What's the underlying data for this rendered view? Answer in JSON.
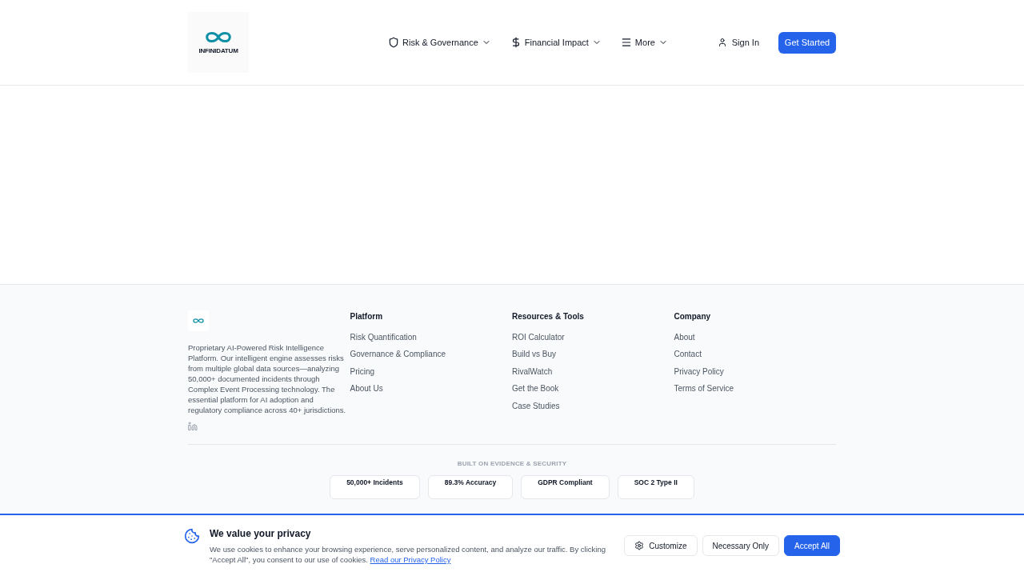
{
  "header": {
    "logo": "INFINIDATUM",
    "nav": [
      {
        "label": "Risk & Governance",
        "kind": "shield"
      },
      {
        "label": "Financial Impact",
        "kind": "dollar"
      },
      {
        "label": "More",
        "kind": "menu"
      }
    ],
    "sign_in": "Sign In",
    "cta": "Get Started"
  },
  "footer": {
    "description": "Proprietary AI-Powered Risk Intelligence Platform. Our intelligent engine assesses risks from multiple global data sources—analyzing 50,000+ documented incidents through Complex Event Processing technology. The essential platform for AI adoption and regulatory compliance across 40+ jurisdictions.",
    "columns": [
      {
        "title": "Platform",
        "links": [
          "Risk Quantification",
          "Governance & Compliance",
          "Pricing",
          "About Us"
        ]
      },
      {
        "title": "Resources & Tools",
        "links": [
          "ROI Calculator",
          "Build vs Buy",
          "RivalWatch",
          "Get the Book",
          "Case Studies"
        ]
      },
      {
        "title": "Company",
        "links": [
          "About",
          "Contact",
          "Privacy Policy",
          "Terms of Service"
        ]
      }
    ],
    "trust_heading": "BUILT ON EVIDENCE & SECURITY",
    "badges": [
      "50,000+ Incidents",
      "89.3% Accuracy",
      "GDPR Compliant",
      "SOC 2 Type II"
    ]
  },
  "cookie_banner": {
    "title": "We value your privacy",
    "text": "We use cookies to enhance your browsing experience, serve personalized content, and analyze our traffic. By clicking \"Accept All\", you consent to our use of cookies.",
    "link": "Read our Privacy Policy",
    "buttons": [
      {
        "label": "Customize",
        "kind": "settings"
      },
      {
        "label": "Necessary Only",
        "kind": "outline"
      },
      {
        "label": "Accept All",
        "kind": "primary"
      }
    ]
  }
}
